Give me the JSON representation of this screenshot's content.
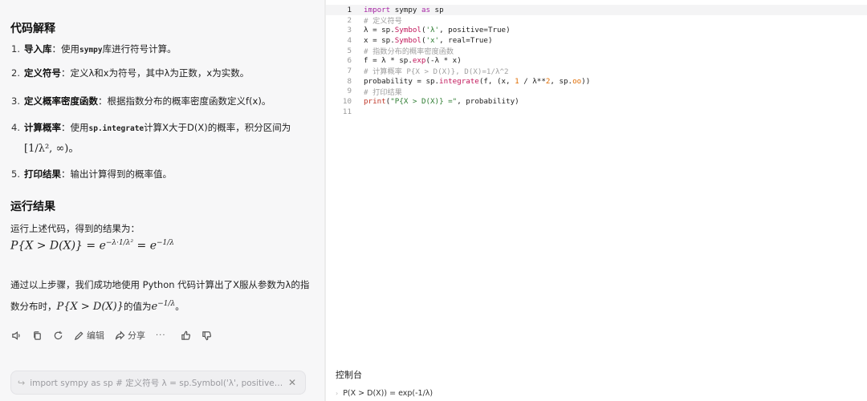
{
  "left": {
    "section1_title": "代码解释",
    "steps": [
      {
        "num": "1.",
        "bold": "导入库",
        "pre": "：使用",
        "code": "sympy",
        "post": "库进行符号计算。"
      },
      {
        "num": "2.",
        "bold": "定义符号",
        "text": "：定义λ和x为符号，其中λ为正数，x为实数。"
      },
      {
        "num": "3.",
        "bold": "定义概率密度函数",
        "text": "：根据指数分布的概率密度函数定义f(x)。"
      },
      {
        "num": "4.",
        "bold": "计算概率",
        "pre": "：使用",
        "code": "sp.integrate",
        "post": "计算X大于D(X)的概率，积分区间为",
        "cont": "[1/λ², ∞)。"
      },
      {
        "num": "5.",
        "bold": "打印结果",
        "text": "：输出计算得到的概率值。"
      }
    ],
    "section2_title": "运行结果",
    "result_intro": "运行上述代码，得到的结果为：",
    "result_formula": "P{X > D(X)} = e^{−λ·1/λ²} = e^{−1/λ}",
    "result_formula_lhs": "P{X > D(X)} = e",
    "result_formula_exp1": "−λ·1/λ²",
    "result_formula_mid": " = e",
    "result_formula_exp2": "−1/λ",
    "conclusion_line1": "通过以上步骤，我们成功地使用 Python 代码计算出了X服从参数为λ的指",
    "conclusion_line2_pre": "数分布时，",
    "conclusion_line2_math": "P{X > D(X)}",
    "conclusion_line2_mid": "的值为",
    "conclusion_line2_e": "e",
    "conclusion_line2_exp": "−1/λ",
    "conclusion_line2_end": "。",
    "actions": {
      "edit_label": "编辑",
      "share_label": "分享",
      "more_label": "···"
    },
    "input_preview": "import sympy as sp # 定义符号 λ = sp.Symbol('λ', positive=True) x = sp...."
  },
  "editor": {
    "lines": [
      {
        "n": "1",
        "text": "import sympy as sp"
      },
      {
        "n": "2",
        "text": "# 定义符号"
      },
      {
        "n": "3",
        "text": "λ = sp.Symbol('λ', positive=True)"
      },
      {
        "n": "4",
        "text": "x = sp.Symbol('x', real=True)"
      },
      {
        "n": "5",
        "text": "# 指数分布的概率密度函数"
      },
      {
        "n": "6",
        "text": "f = λ * sp.exp(-λ * x)"
      },
      {
        "n": "7",
        "text": "# 计算概率 P{X > D(X)}, D(X)=1/λ^2"
      },
      {
        "n": "8",
        "text": "probability = sp.integrate(f, (x, 1 / λ**2, sp.oo))"
      },
      {
        "n": "9",
        "text": "# 打印结果"
      },
      {
        "n": "10",
        "text": "print(\"P{X > D(X)} =\", probability)"
      },
      {
        "n": "11",
        "text": ""
      }
    ],
    "active_line": 1
  },
  "console": {
    "title": "控制台",
    "output": "P(X > D(X)) = exp(-1/λ)"
  }
}
